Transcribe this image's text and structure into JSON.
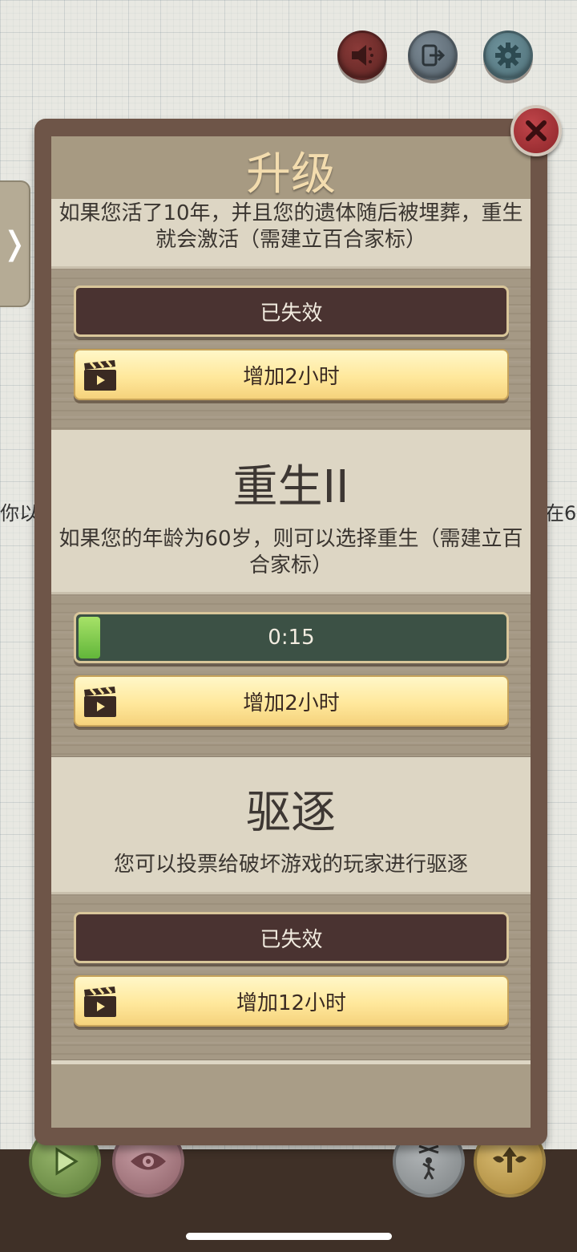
{
  "background": {
    "left_text": "你以",
    "right_text": "在6"
  },
  "top_icons": [
    "speaker-icon",
    "exit-icon",
    "gear-icon"
  ],
  "dialog": {
    "title": "升级",
    "close_icon": "close-icon",
    "sections": [
      {
        "description": "如果您活了10年，并且您的遗体随后被埋葬，重生就会激活（需建立百合家标）",
        "status_label": "已失效",
        "ad_button_label": "增加2小时"
      },
      {
        "title": "重生II",
        "description": "如果您的年龄为60岁，则可以选择重生（需建立百合家标）",
        "progress_label": "0:15",
        "progress_fraction": 0.05,
        "ad_button_label": "增加2小时"
      },
      {
        "title": "驱逐",
        "description": "您可以投票给破坏游戏的玩家进行驱逐",
        "status_label": "已失效",
        "ad_button_label": "增加12小时"
      }
    ]
  },
  "colors": {
    "frame": "#6e5548",
    "dark_button": "#4a3331",
    "progress_track": "#3c5145",
    "progress_fill": "#62b63a",
    "yellow_button": "#ffe89c",
    "close_button": "#8c2529"
  }
}
